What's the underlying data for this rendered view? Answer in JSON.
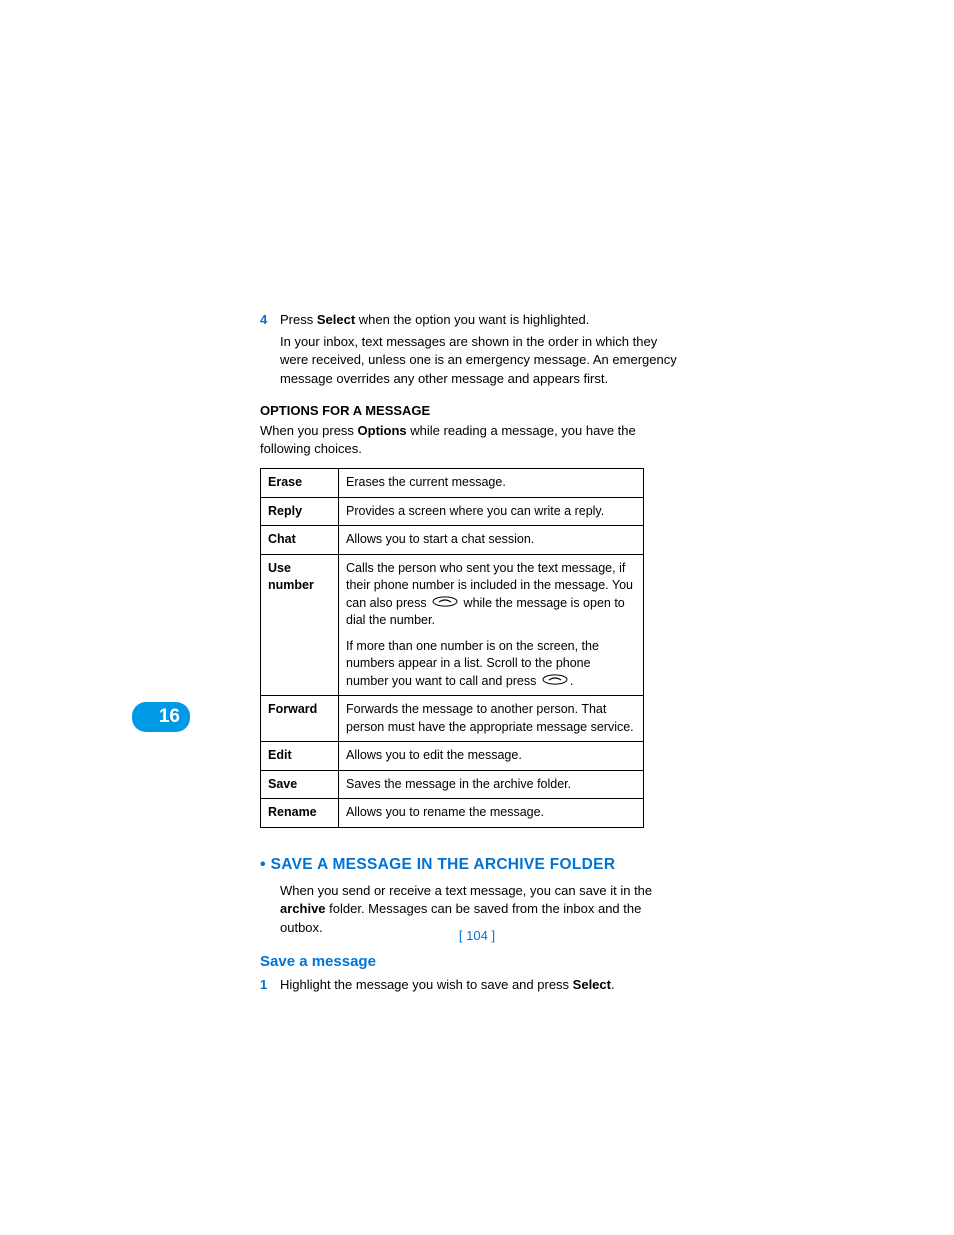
{
  "chapter_number": "16",
  "page_number": "[ 104 ]",
  "step4": {
    "num": "4",
    "line": "Press ",
    "bold1": "Select",
    "line2": " when the option you want is highlighted.",
    "note": "In your inbox, text messages are shown in the order in which they were received, unless one is an emergency message. An emergency message overrides any other message and appears first."
  },
  "options_heading": "OPTIONS FOR A MESSAGE",
  "options_intro1": "When you press ",
  "options_intro_bold": "Options",
  "options_intro2": " while reading a message, you have the following choices.",
  "table": [
    {
      "label": "Erase",
      "desc": "Erases the current message."
    },
    {
      "label": "Reply",
      "desc": "Provides a screen where you can write a reply."
    },
    {
      "label": "Chat",
      "desc": "Allows you to start a chat session."
    },
    {
      "label": "Use number",
      "p1a": "Calls the person who sent you the text message, if their phone number is included in the message. You can also press ",
      "p1b": " while the message is open to dial the number.",
      "p2a": "If more than one number is on the screen, the numbers appear in a list. Scroll to the phone number you want to call and press ",
      "p2b": "."
    },
    {
      "label": "Forward",
      "desc": "Forwards the message to another person. That person must have the appropriate message service."
    },
    {
      "label": "Edit",
      "desc": "Allows you to edit the message."
    },
    {
      "label": "Save",
      "desc": "Saves the message in the archive folder."
    },
    {
      "label": "Rename",
      "desc": "Allows you to rename the message."
    }
  ],
  "section_bullet": " • ",
  "section_title": "SAVE A MESSAGE IN THE ARCHIVE FOLDER",
  "section_body1": "When you send or receive a text message, you can save it in the ",
  "section_body_bold": "archive",
  "section_body2": " folder. Messages can be saved from the inbox and the outbox.",
  "sub_section": "Save a message",
  "step1": {
    "num": "1",
    "line1": "Highlight the message you wish to save and press ",
    "bold": "Select",
    "line2": "."
  }
}
